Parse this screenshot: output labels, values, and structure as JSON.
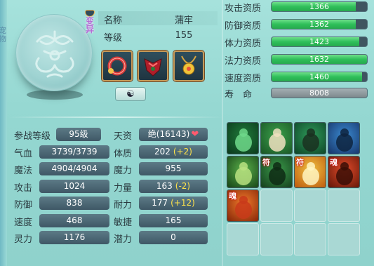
{
  "edge_label": "宠物",
  "pet": {
    "badge": "变异",
    "name_label": "名称",
    "name": "蒲牢",
    "level_label": "等级",
    "level": "155"
  },
  "equipment": [
    {
      "icon": "collar-icon"
    },
    {
      "icon": "armor-icon"
    },
    {
      "icon": "amulet-icon"
    }
  ],
  "yinyang_button": "☯",
  "qualifications": [
    {
      "label": "攻击资质",
      "value": "1366",
      "fill": 0.88,
      "style": "green"
    },
    {
      "label": "防御资质",
      "value": "1362",
      "fill": 0.88,
      "style": "green"
    },
    {
      "label": "体力资质",
      "value": "1423",
      "fill": 0.92,
      "style": "green"
    },
    {
      "label": "法力资质",
      "value": "1632",
      "fill": 1.0,
      "style": "green"
    },
    {
      "label": "速度资质",
      "value": "1460",
      "fill": 0.95,
      "style": "green"
    },
    {
      "label": "寿　命",
      "value": "8008",
      "fill": 1.0,
      "style": "grey"
    }
  ],
  "attributes_left": [
    {
      "label": "参战等级",
      "value": "95级"
    },
    {
      "label": "气血",
      "value": "3739/3739"
    },
    {
      "label": "魔法",
      "value": "4904/4904"
    },
    {
      "label": "攻击",
      "value": "1024"
    },
    {
      "label": "防御",
      "value": "838"
    },
    {
      "label": "速度",
      "value": "468"
    },
    {
      "label": "灵力",
      "value": "1176"
    }
  ],
  "attributes_right": [
    {
      "label": "天资",
      "value": "绝(16143)",
      "bonus": "",
      "heart": "❤"
    },
    {
      "label": "体质",
      "value": "202",
      "bonus": "(+2)"
    },
    {
      "label": "魔力",
      "value": "955",
      "bonus": ""
    },
    {
      "label": "力量",
      "value": "163",
      "bonus": "(-2)"
    },
    {
      "label": "耐力",
      "value": "177",
      "bonus": "(+12)"
    },
    {
      "label": "敏捷",
      "value": "165",
      "bonus": ""
    },
    {
      "label": "潜力",
      "value": "0",
      "bonus": ""
    }
  ],
  "skills": [
    {
      "icon": "skill-figure-icon"
    },
    {
      "icon": "skill-hand-icon"
    },
    {
      "icon": "skill-cat-icon"
    },
    {
      "icon": "skill-wolf-icon"
    },
    {
      "icon": "skill-bell-icon"
    },
    {
      "icon": "skill-tiger-icon",
      "tag": "符"
    },
    {
      "icon": "skill-light-icon",
      "tag": "符"
    },
    {
      "icon": "skill-beast-icon",
      "tag": "魂"
    },
    {
      "icon": "skill-muscle-icon",
      "tag": "魂"
    },
    {
      "icon": "empty"
    },
    {
      "icon": "empty"
    },
    {
      "icon": "empty"
    },
    {
      "icon": "empty"
    },
    {
      "icon": "empty"
    },
    {
      "icon": "empty"
    },
    {
      "icon": "empty"
    }
  ]
}
